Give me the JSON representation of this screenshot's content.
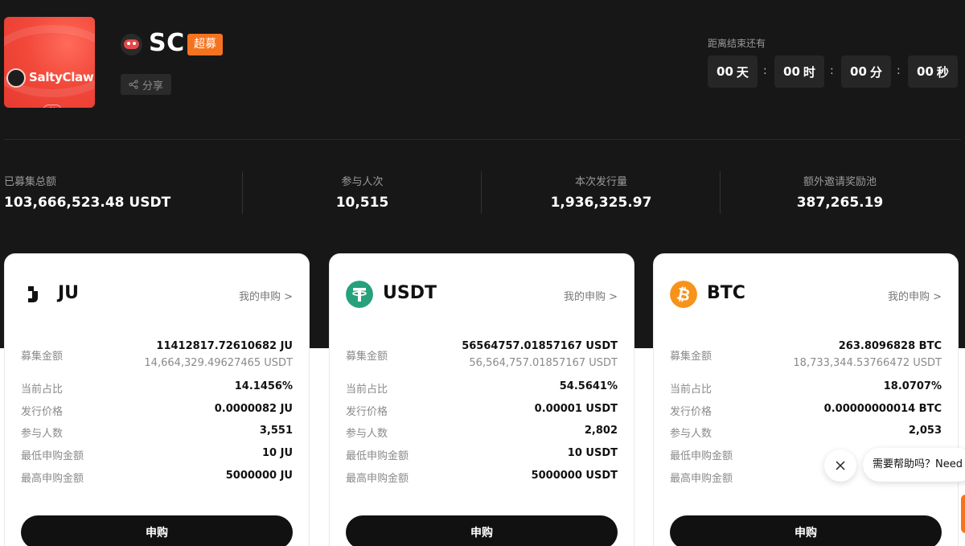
{
  "project": {
    "logo_text": "SaltyClaw",
    "logo_mark": "JU",
    "symbol": "SC",
    "badge": "超募",
    "share_label": "分享"
  },
  "countdown": {
    "label": "距离结束还有",
    "days_value": "00",
    "days_unit": "天",
    "hours_value": "00",
    "hours_unit": "时",
    "minutes_value": "00",
    "minutes_unit": "分",
    "seconds_value": "00",
    "seconds_unit": "秒",
    "separator": ":"
  },
  "stats": [
    {
      "label": "已募集总额",
      "value": "103,666,523.48 USDT"
    },
    {
      "label": "参与人次",
      "value": "10,515"
    },
    {
      "label": "本次发行量",
      "value": "1,936,325.97"
    },
    {
      "label": "额外邀请奖励池",
      "value": "387,265.19"
    }
  ],
  "cards": [
    {
      "name": "JU",
      "link": "我的申购 >",
      "rows": {
        "raised": {
          "label": "募集金额",
          "value": "11412817.72610682 JU",
          "sub": "14,664,329.49627465 USDT"
        },
        "share": {
          "label": "当前占比",
          "value": "14.1456%"
        },
        "price": {
          "label": "发行价格",
          "value": "0.0000082 JU"
        },
        "participants": {
          "label": "参与人数",
          "value": "3,551"
        },
        "min": {
          "label": "最低申购金额",
          "value": "10 JU"
        },
        "max": {
          "label": "最高申购金额",
          "value": "5000000 JU"
        }
      },
      "button": "申购"
    },
    {
      "name": "USDT",
      "link": "我的申购 >",
      "rows": {
        "raised": {
          "label": "募集金额",
          "value": "56564757.01857167 USDT",
          "sub": "56,564,757.01857167 USDT"
        },
        "share": {
          "label": "当前占比",
          "value": "54.5641%"
        },
        "price": {
          "label": "发行价格",
          "value": "0.00001 USDT"
        },
        "participants": {
          "label": "参与人数",
          "value": "2,802"
        },
        "min": {
          "label": "最低申购金额",
          "value": "10 USDT"
        },
        "max": {
          "label": "最高申购金额",
          "value": "5000000 USDT"
        }
      },
      "button": "申购"
    },
    {
      "name": "BTC",
      "link": "我的申购 >",
      "rows": {
        "raised": {
          "label": "募集金额",
          "value": "263.8096828 BTC",
          "sub": "18,733,344.53766472 USDT"
        },
        "share": {
          "label": "当前占比",
          "value": "18.0707%"
        },
        "price": {
          "label": "发行价格",
          "value": "0.00000000014 BTC"
        },
        "participants": {
          "label": "参与人数",
          "value": "2,053"
        },
        "min": {
          "label": "最低申购金额",
          "value": ""
        },
        "max": {
          "label": "最高申购金额",
          "value": ""
        }
      },
      "button": "申购"
    }
  ],
  "help": {
    "text": "需要帮助吗？Need"
  },
  "colors": {
    "accent": "#f5731f",
    "usdt": "#26a17b",
    "btc": "#f7931a",
    "dark_bg": "#171717"
  }
}
